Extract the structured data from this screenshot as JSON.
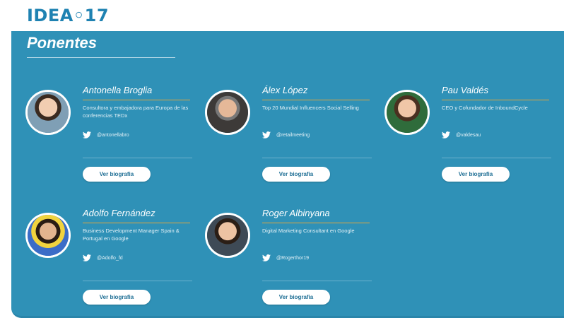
{
  "header": {
    "logo": "IDEA◦17"
  },
  "section": {
    "title": "Ponentes"
  },
  "button_label": "Ver biografia",
  "speakers": [
    {
      "name": "Antonella Broglia",
      "role": "Consultora y embajadora para Europa de las conferencias TEDx",
      "twitter": "@antonellabro"
    },
    {
      "name": "Álex López",
      "role": "Top 20 Mundial Influencers Social Selling",
      "twitter": "@retailmeeting"
    },
    {
      "name": "Pau Valdés",
      "role": "CEO y Cofundador de InboundCycle",
      "twitter": "@valdesau"
    },
    {
      "name": "Adolfo Fernández",
      "role": "Business Development Manager Spain & Portugal en Google",
      "twitter": "@Adolfo_fd"
    },
    {
      "name": "Roger Albinyana",
      "role": "Digital Marketing Consultant en Google",
      "twitter": "@Rogerthor19"
    }
  ],
  "colors": {
    "panel": "#2f91b7",
    "accent": "#e2a63c",
    "logo": "#1f82b2"
  }
}
